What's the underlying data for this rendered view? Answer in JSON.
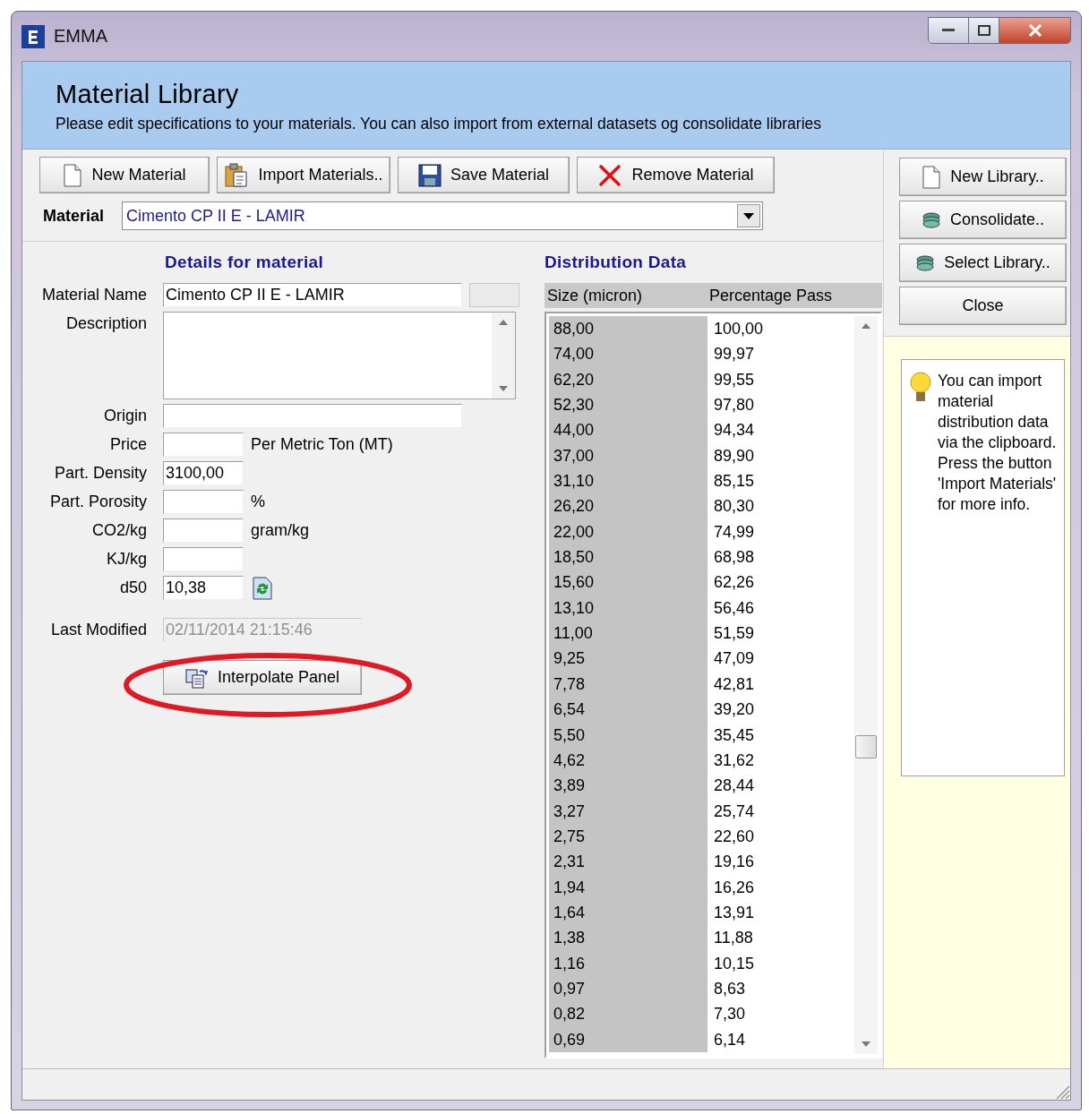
{
  "window": {
    "title": "EMMA"
  },
  "header": {
    "title": "Material Library",
    "subtitle": "Please edit specifications to your materials. You can also import from external datasets og consolidate libraries"
  },
  "toolbar": [
    {
      "label": "New Material"
    },
    {
      "label": "Import Materials.."
    },
    {
      "label": "Save Material"
    },
    {
      "label": "Remove Material"
    }
  ],
  "material": {
    "label": "Material",
    "value": "Cimento CP II E - LAMIR"
  },
  "details": {
    "heading": "Details for material",
    "fields": [
      {
        "label": "Material Name",
        "value": "Cimento CP II E - LAMIR",
        "kind": "name"
      },
      {
        "label": "Description",
        "kind": "memo"
      },
      {
        "label": "Origin",
        "kind": "wide"
      },
      {
        "label": "Price",
        "kind": "short",
        "unit": "Per Metric Ton (MT)"
      },
      {
        "label": "Part. Density",
        "value": "3100,00",
        "kind": "short"
      },
      {
        "label": "Part. Porosity",
        "kind": "short",
        "unit": "%"
      },
      {
        "label": "CO2/kg",
        "kind": "short",
        "unit": "gram/kg"
      },
      {
        "label": "KJ/kg",
        "kind": "short"
      },
      {
        "label": "d50",
        "value": "10,38",
        "kind": "calc"
      },
      {
        "label": "Last Modified",
        "value": "02/11/2014 21:15:46",
        "kind": "date",
        "disabled": true
      }
    ],
    "button": {
      "label": "Interpolate Panel",
      "highlighted": true
    }
  },
  "distribution": {
    "heading": "Distribution Data",
    "columns": [
      "Size (micron)",
      "Percentage Pass"
    ],
    "rows": [
      [
        "88,00",
        "100,00"
      ],
      [
        "74,00",
        "99,97"
      ],
      [
        "62,20",
        "99,55"
      ],
      [
        "52,30",
        "97,80"
      ],
      [
        "44,00",
        "94,34"
      ],
      [
        "37,00",
        "89,90"
      ],
      [
        "31,10",
        "85,15"
      ],
      [
        "26,20",
        "80,30"
      ],
      [
        "22,00",
        "74,99"
      ],
      [
        "18,50",
        "68,98"
      ],
      [
        "15,60",
        "62,26"
      ],
      [
        "13,10",
        "56,46"
      ],
      [
        "11,00",
        "51,59"
      ],
      [
        "9,25",
        "47,09"
      ],
      [
        "7,78",
        "42,81"
      ],
      [
        "6,54",
        "39,20"
      ],
      [
        "5,50",
        "35,45"
      ],
      [
        "4,62",
        "31,62"
      ],
      [
        "3,89",
        "28,44"
      ],
      [
        "3,27",
        "25,74"
      ],
      [
        "2,75",
        "22,60"
      ],
      [
        "2,31",
        "19,16"
      ],
      [
        "1,94",
        "16,26"
      ],
      [
        "1,64",
        "13,91"
      ],
      [
        "1,38",
        "11,88"
      ],
      [
        "1,16",
        "10,15"
      ],
      [
        "0,97",
        "8,63"
      ],
      [
        "0,82",
        "7,30"
      ],
      [
        "0,69",
        "6,14"
      ]
    ]
  },
  "side_buttons": [
    {
      "label": "New Library.."
    },
    {
      "label": "Consolidate.."
    },
    {
      "label": "Select Library.."
    },
    {
      "label": "Close"
    }
  ],
  "tip": {
    "text": "You can import material distribution data via the clipboard. Press the button 'Import Materials' for more info."
  }
}
